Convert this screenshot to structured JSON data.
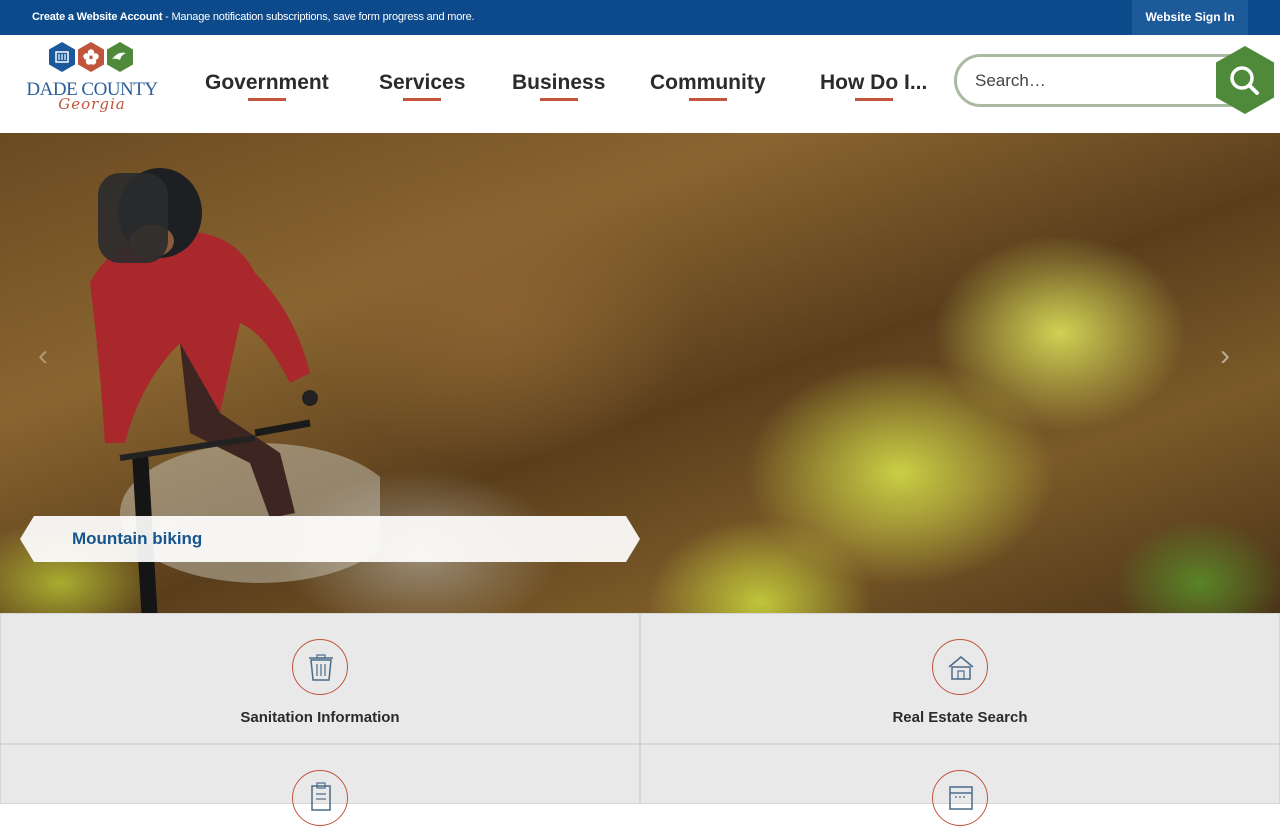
{
  "topbar": {
    "account_link": "Create a Website Account",
    "account_desc": " - Manage notification subscriptions, save form progress and more.",
    "signin": "Website Sign In"
  },
  "logo": {
    "line1": "DADE COUNTY",
    "line2": "Georgia",
    "hex_colors": [
      "#1a5a9c",
      "#c0553b",
      "#4e8a3a"
    ]
  },
  "nav": [
    {
      "label": "Government"
    },
    {
      "label": "Services"
    },
    {
      "label": "Business"
    },
    {
      "label": "Community"
    },
    {
      "label": "How Do I..."
    }
  ],
  "search": {
    "placeholder": "Search…",
    "button_icon": "search-icon",
    "button_color": "#4e8a3a"
  },
  "hero": {
    "caption": "Mountain biking",
    "prev_icon": "chevron-left-icon",
    "next_icon": "chevron-right-icon"
  },
  "quick_links": [
    {
      "label": "Sanitation Information",
      "icon": "trash-can-icon"
    },
    {
      "label": "Real Estate Search",
      "icon": "house-icon"
    },
    {
      "label": "",
      "icon": "clipboard-icon"
    },
    {
      "label": "",
      "icon": "calendar-icon"
    }
  ],
  "colors": {
    "topbar": "#0d4a8b",
    "accent": "#c0553b",
    "nav_text": "#2b2b2b",
    "caption_text": "#17558f"
  }
}
